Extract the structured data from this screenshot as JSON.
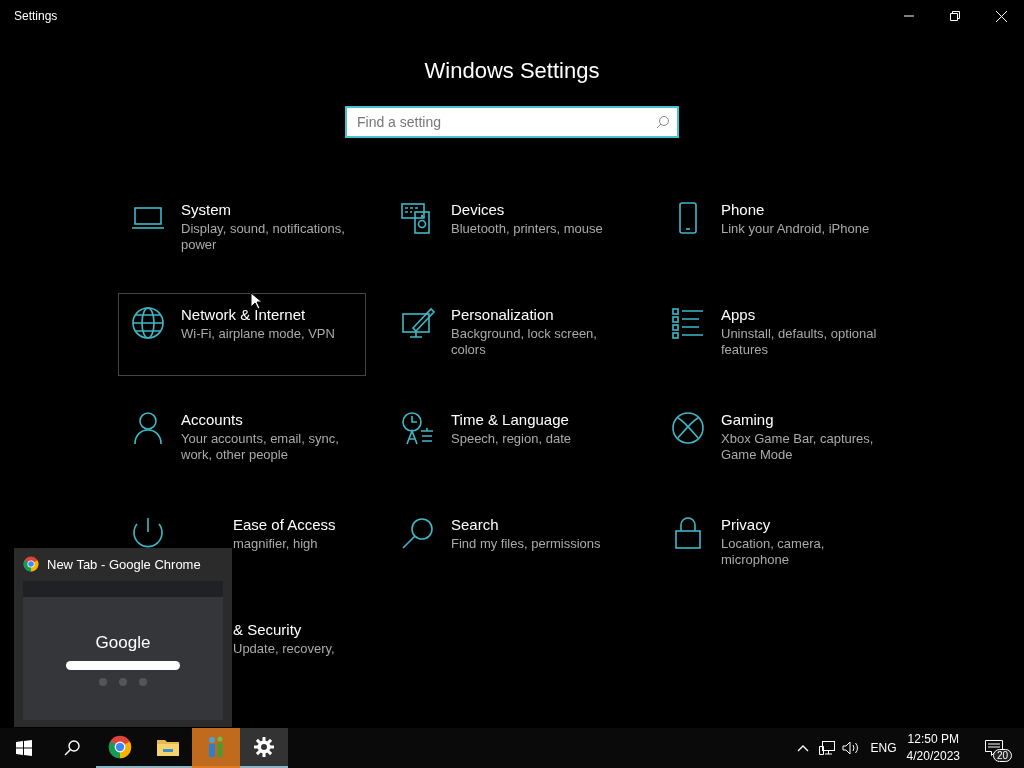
{
  "window": {
    "title": "Settings"
  },
  "heading": "Windows Settings",
  "search": {
    "placeholder": "Find a setting"
  },
  "tiles": [
    {
      "title": "System",
      "description": "Display, sound, notifications, power",
      "kind": "full",
      "hovered": false
    },
    {
      "title": "Devices",
      "description": "Bluetooth, printers, mouse",
      "kind": "full",
      "hovered": false
    },
    {
      "title": "Phone",
      "description": "Link your Android, iPhone",
      "kind": "full",
      "hovered": false
    },
    {
      "title": "Network & Internet",
      "description": "Wi-Fi, airplane mode, VPN",
      "kind": "full",
      "hovered": true
    },
    {
      "title": "Personalization",
      "description": "Background, lock screen, colors",
      "kind": "full",
      "hovered": false
    },
    {
      "title": "Apps",
      "description": "Uninstall, defaults, optional features",
      "kind": "full",
      "hovered": false
    },
    {
      "title": "Accounts",
      "description": "Your accounts, email, sync, work, other people",
      "kind": "full",
      "hovered": false
    },
    {
      "title": "Time & Language",
      "description": "Speech, region, date",
      "kind": "full",
      "hovered": false
    },
    {
      "title": "Gaming",
      "description": "Xbox Game Bar, captures, Game Mode",
      "kind": "full",
      "hovered": false
    },
    {
      "title": "Ease of Access",
      "description": "magnifier, high",
      "kind": "covered",
      "hovered": false
    },
    {
      "title": "Search",
      "description": "Find my files, permissions",
      "kind": "full",
      "hovered": false
    },
    {
      "title": "Privacy",
      "description": "Location, camera, microphone",
      "kind": "full",
      "hovered": false
    },
    {
      "title": "& Security",
      "description": "Update, recovery,",
      "kind": "covered",
      "hovered": false
    }
  ],
  "preview": {
    "title": "New Tab - Google Chrome",
    "thumbnail_logo": "Google"
  },
  "taskbar": {
    "apps": [
      {
        "running": true,
        "attention": false,
        "active": false
      },
      {
        "running": true,
        "attention": false,
        "active": false
      },
      {
        "running": false,
        "attention": true,
        "active": false
      },
      {
        "running": true,
        "attention": false,
        "active": true
      }
    ],
    "language": "ENG",
    "time": "12:50 PM",
    "date": "4/20/2023",
    "notification_count": "20"
  }
}
